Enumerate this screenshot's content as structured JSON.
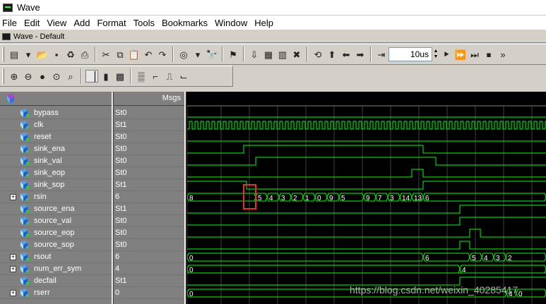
{
  "window": {
    "title": "Wave"
  },
  "menu": [
    "File",
    "Edit",
    "View",
    "Add",
    "Format",
    "Tools",
    "Bookmarks",
    "Window",
    "Help"
  ],
  "subwindow": {
    "title": "Wave - Default"
  },
  "toolbar": {
    "time_value": "10us"
  },
  "signals_header": {
    "values_label": "Msgs"
  },
  "signals": [
    {
      "name": "bypass",
      "value": "St0",
      "expandable": false
    },
    {
      "name": "clk",
      "value": "St1",
      "expandable": false
    },
    {
      "name": "reset",
      "value": "St0",
      "expandable": false
    },
    {
      "name": "sink_ena",
      "value": "St0",
      "expandable": false
    },
    {
      "name": "sink_val",
      "value": "St0",
      "expandable": false
    },
    {
      "name": "sink_eop",
      "value": "St0",
      "expandable": false
    },
    {
      "name": "sink_sop",
      "value": "St1",
      "expandable": false
    },
    {
      "name": "rsin",
      "value": "6",
      "expandable": true
    },
    {
      "name": "source_ena",
      "value": "St1",
      "expandable": false
    },
    {
      "name": "source_val",
      "value": "St0",
      "expandable": false
    },
    {
      "name": "source_eop",
      "value": "St0",
      "expandable": false
    },
    {
      "name": "source_sop",
      "value": "St0",
      "expandable": false
    },
    {
      "name": "rsout",
      "value": "6",
      "expandable": true
    },
    {
      "name": "num_err_sym",
      "value": "4",
      "expandable": true
    },
    {
      "name": "decfail",
      "value": "St1",
      "expandable": false
    },
    {
      "name": "rserr",
      "value": "0",
      "expandable": true
    }
  ],
  "bus_labels": {
    "rsin": [
      "8",
      "5",
      "4",
      "3",
      "2",
      "1",
      "0",
      "9",
      "5",
      "9",
      "7",
      "3",
      "14",
      "13",
      "6"
    ],
    "rsout": [
      "0",
      "6",
      "5",
      "4",
      "3",
      "2"
    ],
    "num_err_sym": [
      "0",
      "4"
    ],
    "rserr": [
      "0",
      "4",
      "0"
    ]
  },
  "colors": {
    "wave": "#00ff00",
    "highlight": "#e03030",
    "grid": "#404040"
  },
  "watermark": "https://blog.csdn.net/weixin_40285417"
}
